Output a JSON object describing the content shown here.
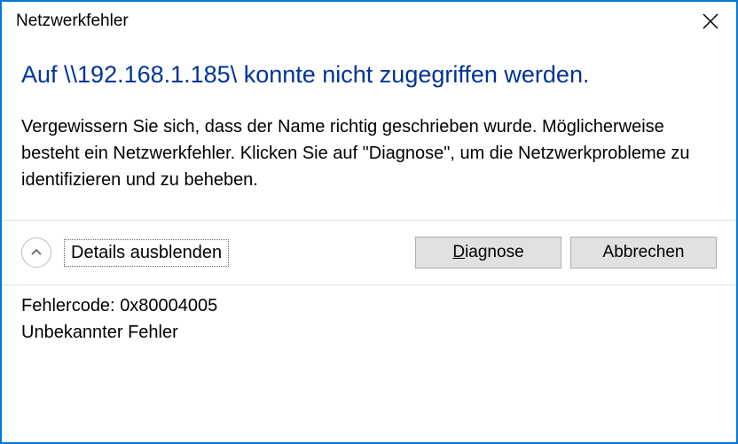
{
  "titlebar": {
    "title": "Netzwerkfehler"
  },
  "main": {
    "heading": "Auf \\\\192.168.1.185\\ konnte nicht zugegriffen werden.",
    "body": "Vergewissern Sie sich, dass der Name richtig geschrieben wurde. Möglicherweise besteht ein Netzwerkfehler. Klicken Sie auf \"Diagnose\", um die Netzwerkprobleme zu identifizieren und zu beheben."
  },
  "actions": {
    "details_toggle": "Details ausblenden",
    "diagnose_prefix": "D",
    "diagnose_rest": "iagnose",
    "cancel": "Abbrechen"
  },
  "details": {
    "error_code_label": "Fehlercode:",
    "error_code_value": "0x80004005",
    "error_message": "Unbekannter Fehler"
  }
}
